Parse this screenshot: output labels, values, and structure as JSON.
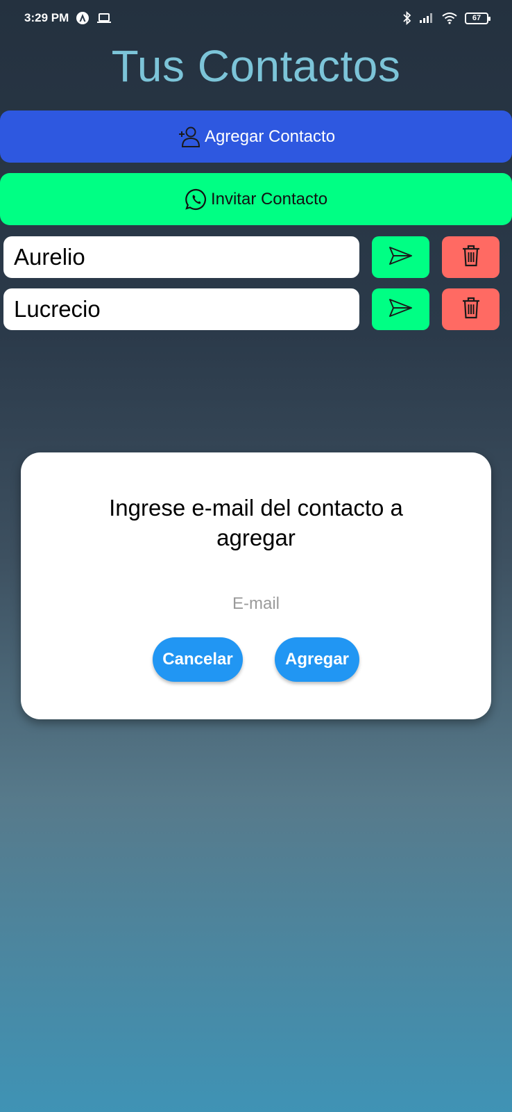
{
  "status_bar": {
    "time": "3:29 PM",
    "battery": "67",
    "icons": [
      "app-notification-icon",
      "laptop-icon",
      "bluetooth-icon",
      "signal-icon",
      "wifi-icon",
      "battery-icon"
    ]
  },
  "header": {
    "title": "Tus Contactos"
  },
  "actions": {
    "add_label": "Agregar Contacto",
    "add_icon": "person-add-icon",
    "invite_label": "Invitar Contacto",
    "invite_icon": "whatsapp-icon"
  },
  "contacts": [
    {
      "name": "Aurelio",
      "send_icon": "send-icon",
      "delete_icon": "trash-icon"
    },
    {
      "name": "Lucrecio",
      "send_icon": "send-icon",
      "delete_icon": "trash-icon"
    }
  ],
  "dialog": {
    "message": "Ingrese e-mail del contacto a agregar",
    "email_value": "",
    "email_placeholder": "E-mail",
    "cancel_label": "Cancelar",
    "confirm_label": "Agregar"
  },
  "colors": {
    "title": "#7cc4d8",
    "add_button": "#2e58e0",
    "invite_button": "#00ff84",
    "send_button": "#00ff84",
    "delete_button": "#ff6a63",
    "dialog_buttons": "#2196f3"
  }
}
